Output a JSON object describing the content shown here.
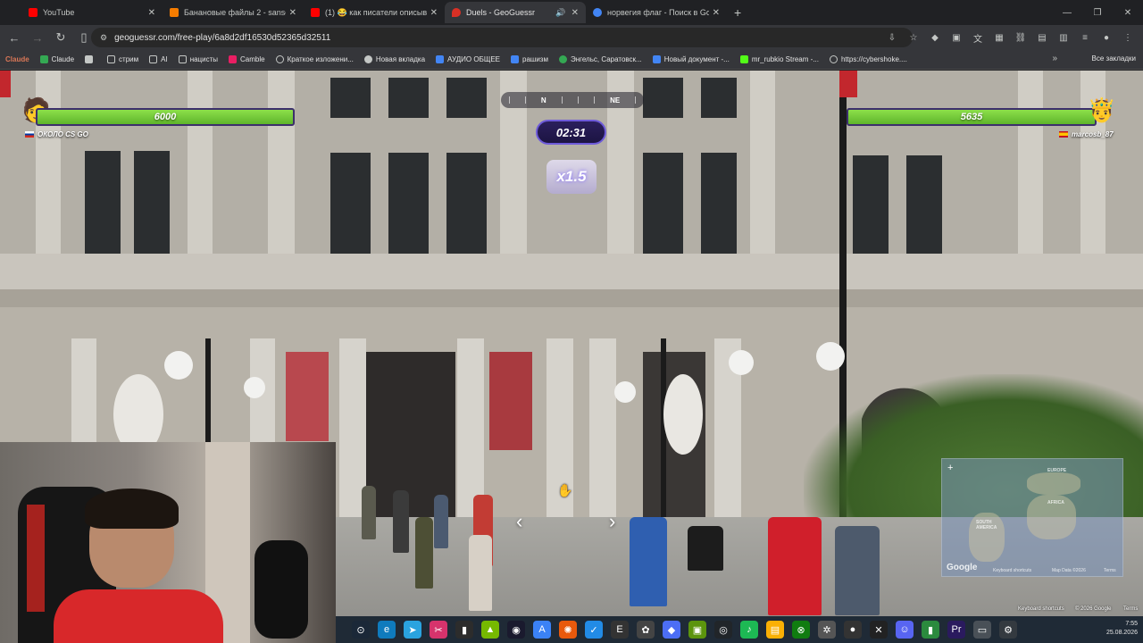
{
  "browser": {
    "tabs": [
      {
        "title": "YouTube",
        "color": "#ff0000",
        "active": false,
        "audio": false
      },
      {
        "title": "Банановые файлы 2 - sansgot",
        "color": "#f57c00",
        "active": false,
        "audio": false
      },
      {
        "title": "(1) 😂 как писатели описыва",
        "color": "#ff0000",
        "active": false,
        "audio": false
      },
      {
        "title": "Duels - GeoGuessr",
        "color": "#d93025",
        "active": true,
        "audio": true
      },
      {
        "title": "норвегия флаг - Поиск в Goo",
        "color": "#4285f4",
        "active": false,
        "audio": false
      }
    ],
    "address": "geoguessr.com/free-play/6a8d2df16530d52365d32511",
    "bookmarks": [
      {
        "label": "Claude",
        "color": "#d97757"
      },
      {
        "label": "Claude",
        "color": "#d97757"
      },
      {
        "label": "стрим",
        "color": "#c4c7c5"
      },
      {
        "label": "AI",
        "color": "#c4c7c5"
      },
      {
        "label": "нацисты",
        "color": "#c4c7c5"
      },
      {
        "label": "Camble",
        "color": "#e91e63"
      },
      {
        "label": "Краткое изложени...",
        "color": "#c4c7c5"
      },
      {
        "label": "Новая вкладка",
        "color": "#c4c7c5"
      },
      {
        "label": "АУДИО ОБЩЕЕ",
        "color": "#4285f4"
      },
      {
        "label": "рашизм",
        "color": "#4285f4"
      },
      {
        "label": "Энгельс, Саратовск...",
        "color": "#34a853"
      },
      {
        "label": "Новый документ -...",
        "color": "#4285f4"
      },
      {
        "label": "mr_rubkio Stream -...",
        "color": "#53fc18"
      },
      {
        "label": "https://cybershoke....",
        "color": "#c4c7c5"
      }
    ],
    "all_bookmarks": "Все закладки"
  },
  "game": {
    "compass": {
      "n": "N",
      "ne": "NE"
    },
    "timer": "02:31",
    "multiplier": "x1.5",
    "left_player": {
      "score": "6000",
      "name": "ОКОЛО CS GO",
      "health": 1.0
    },
    "right_player": {
      "score": "5635",
      "name": "marcosb_87",
      "health": 0.94
    },
    "minimap": {
      "labels": [
        "EUROPE",
        "AFRICA",
        "SOUTH AMERICA"
      ],
      "keyboard": "Keyboard shortcuts",
      "mapdata": "Map Data ©2026",
      "terms": "Terms"
    },
    "footer": {
      "keyboard": "Keyboard shortcuts",
      "copyright": "© 2026 Google",
      "terms": "Terms"
    },
    "google_logo": "Google"
  },
  "taskbar": {
    "time": "7:55",
    "date": "25.08.2026"
  }
}
